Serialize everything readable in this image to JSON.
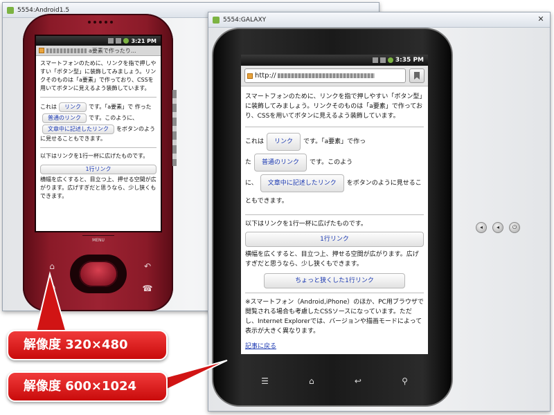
{
  "windows": {
    "left": {
      "title": "5554:Android1.5"
    },
    "right": {
      "title": "5554:GALAXY"
    }
  },
  "controls": {
    "close": "✕"
  },
  "g1": {
    "status_time": "3:21 PM",
    "tab_title": "a要素で作ったり...",
    "menu_label": "MENU",
    "intro": "スマートフォンのために、リンクを指で押しやすい「ボタン型」に装飾してみましょう。リンクそのものは「a要素」で作っており、CSSを用いてボタンに見えるよう装飾しています。",
    "line1_pre": "これは",
    "line1_btn": "リンク",
    "line1_post": "です。「a要素」で",
    "line2_pre": "作った",
    "line2_btn": "普通のリンク",
    "line2_post": "です。このように、",
    "line3_btn": "文章中に記述したリンク",
    "line3_post": "をボタンのように見せることもできます。",
    "full_intro": "以下はリンクを1行一杯に広げたものです。",
    "full_btn": "1行リンク",
    "wide_note": "横幅を広くすると、目立つ上、押せる空間が広がります。広げすぎだと思うなら、少し狭くもできます。"
  },
  "galaxy": {
    "status_time": "3:35 PM",
    "url_prefix": "http://",
    "intro": "スマートフォンのために、リンクを指で押しやすい「ボタン型」に装飾してみましょう。リンクそのものは「a要素」で作っており、CSSを用いてボタンに見えるよう装飾しています。",
    "line1_pre": "これは",
    "line1_btn": "リンク",
    "line1_post": "です。「a要素」で作っ",
    "line2_pre": "た",
    "line2_btn": "普通のリンク",
    "line2_post": "です。このよう",
    "line3_pre": "に、",
    "line3_btn": "文章中に記述したリンク",
    "line3_post": "をボタンのように見せることもできます。",
    "full_intro": "以下はリンクを1行一杯に広げたものです。",
    "full_btn": "1行リンク",
    "wide_note": "横幅を広くすると、目立つ上、押せる空間が広がります。広げすぎだと思うなら、少し狭くもできます。",
    "narrow_btn": "ちょっと狭くした1行リンク",
    "footnote": "※スマートフォン（Android,iPhone）のほか、PC用ブラウザで閲覧される場合も考慮したCSSソースになっています。ただし、Internet Explorerでは、バージョンや描画モードによって表示が大きく異なります。",
    "back_link": "記事に戻る"
  },
  "callouts": {
    "res_small": "解像度 320×480",
    "res_large": "解像度 600×1024"
  }
}
